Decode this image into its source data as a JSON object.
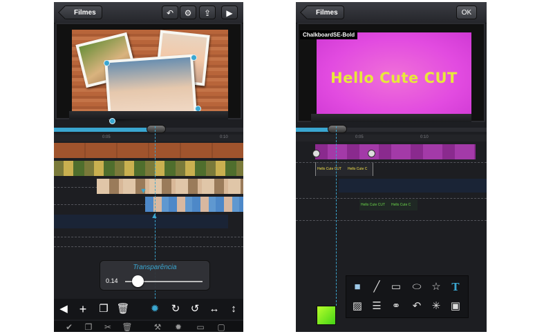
{
  "left_screen": {
    "back_label": "Filmes",
    "toolbar_icons": [
      "undo-icon",
      "gear-icon",
      "share-icon",
      "play-icon"
    ],
    "ruler_ticks": [
      "0:05",
      "0:10"
    ],
    "transparency_popup": {
      "title": "Transparência",
      "value": "0.14",
      "slider_fraction": 0.14
    },
    "bottom_toolbar_icons": [
      "back-arrow-icon",
      "plus-icon",
      "copy-icon",
      "trash-icon",
      "sun-icon",
      "redo-icon",
      "undo-icon",
      "expand-horizontal-icon",
      "expand-vertical-icon"
    ],
    "clipped_toolbar_icons": [
      "check-icon",
      "copy-icon",
      "scissors-icon",
      "trash-icon",
      "tools-icon",
      "sun-icon",
      "rectangle-icon",
      "rounded-rect-icon"
    ]
  },
  "right_screen": {
    "back_label": "Filmes",
    "ok_label": "OK",
    "font_label": "ChalkboardSE-Bold",
    "preview_text": "Hello Cute CUT",
    "ruler_ticks": [
      "0:05",
      "0:10"
    ],
    "clip_texts": [
      "Hello Cute CUT",
      "Hello Cute C",
      "Hello Cute CUT",
      "Hello Cute C"
    ],
    "palette_row1": [
      "rounded-rect-icon",
      "line-icon",
      "rectangle-icon",
      "ellipse-icon",
      "star-icon",
      "text-icon"
    ],
    "palette_row2": [
      "image-icon",
      "lines-icon",
      "link-icon",
      "undo-icon",
      "sparkle-icon",
      "save-icon"
    ],
    "text_tool_glyph": "T"
  },
  "colors": {
    "accent": "#3aa6d0",
    "background": "#1d1e22",
    "magenta": "#e24be0",
    "text_yellow": "#e8e83a"
  }
}
